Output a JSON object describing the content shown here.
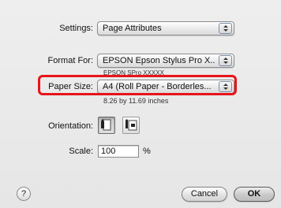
{
  "settings": {
    "label": "Settings:",
    "value": "Page Attributes"
  },
  "format_for": {
    "label": "Format For:",
    "value": "EPSON Epson Stylus Pro X...",
    "subtext": "EPSON SPro XXXXX"
  },
  "paper_size": {
    "label": "Paper Size:",
    "value": "A4 (Roll Paper - Borderles...",
    "dimensions": "8.26 by 11.69 inches"
  },
  "orientation": {
    "label": "Orientation:",
    "options": [
      "portrait-icon",
      "landscape-icon"
    ],
    "selected": "portrait"
  },
  "scale": {
    "label": "Scale:",
    "value": "100",
    "unit": "%"
  },
  "help": {
    "label": "?"
  },
  "buttons": {
    "cancel": "Cancel",
    "ok": "OK"
  },
  "colors": {
    "highlight": "#e8141a"
  }
}
